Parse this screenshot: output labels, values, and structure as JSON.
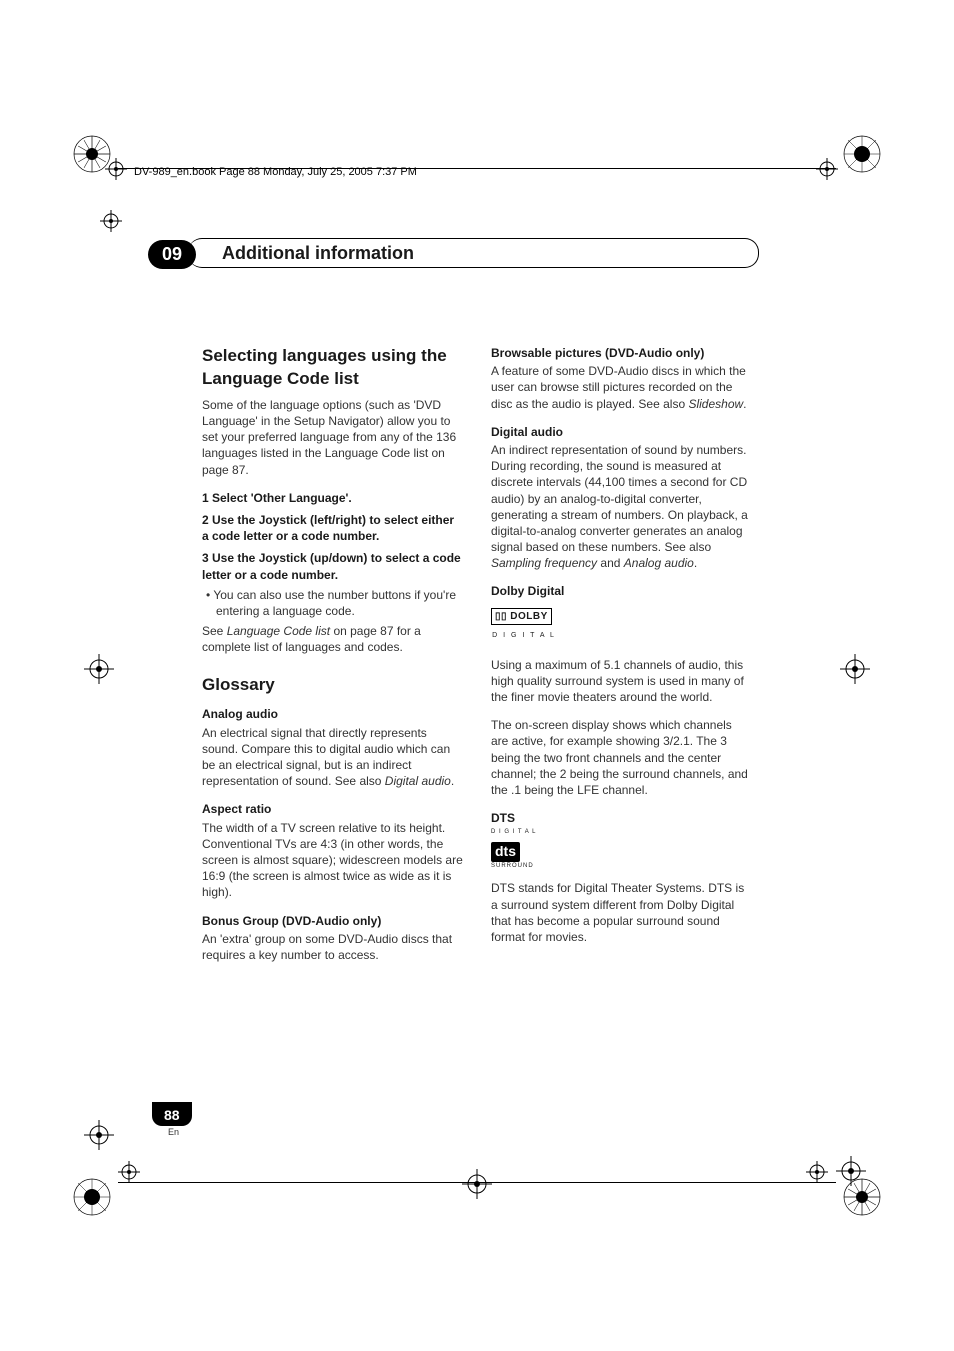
{
  "chapter": {
    "num": "09",
    "title": "Additional information"
  },
  "header_trail": "DV-989_en.book  Page 88  Monday, July 25, 2005  7:37 PM",
  "page_number": "88",
  "page_lang": "En",
  "left": {
    "h1": "Selecting languages using the Language Code list",
    "intro": "Some of the language options (such as 'DVD Language' in the Setup Navigator) allow you to set your preferred language from any of the 136 languages listed in the Language Code list on page 87.",
    "step1": "1    Select 'Other Language'.",
    "step2": "2    Use the Joystick (left/right) to select either a code letter or a code number.",
    "step3": "3    Use the Joystick (up/down) to select a code letter or a code number.",
    "bullet": "• You can also use the number buttons if you're entering a language code.",
    "ref_a": "See ",
    "ref_i": "Language Code list",
    "ref_b": " on page 87 for a complete list of languages and codes.",
    "h2": "Glossary",
    "analog_t": "Analog audio",
    "analog_b_a": "An electrical signal that directly represents sound. Compare this to digital audio which can be an electrical signal, but is an indirect representation of sound. See also ",
    "analog_b_i": "Digital audio",
    "analog_b_c": ".",
    "aspect_t": "Aspect ratio",
    "aspect_b": "The width of a TV screen relative to its height. Conventional TVs are 4:3 (in other words, the screen is almost square); widescreen models are 16:9 (the screen is almost twice as wide as it is high).",
    "bonus_t": "Bonus Group (DVD-Audio only)",
    "bonus_b": "An 'extra' group on some DVD-Audio discs that requires a key number to access."
  },
  "right": {
    "brow_t": "Browsable pictures (DVD-Audio only)",
    "brow_a": "A feature of some DVD-Audio discs in which the user can browse still pictures recorded on the disc as the audio is played. See also ",
    "brow_i": "Slideshow",
    "brow_c": ".",
    "dig_t": "Digital audio",
    "dig_a": "An indirect representation of sound by numbers. During recording, the sound is measured at discrete intervals (44,100 times a second for CD audio) by an analog-to-digital converter, generating a stream of numbers. On playback, a digital-to-analog converter generates an analog signal based on these numbers. See also ",
    "dig_i1": "Sampling frequency",
    "dig_m": " and ",
    "dig_i2": "Analog audio",
    "dig_c": ".",
    "dolby_t": "Dolby Digital",
    "dolby_logo": "DOLBY",
    "dolby_sub": "D I G I T A L",
    "dolby_p1": "Using a maximum of 5.1 channels of audio, this high quality surround system is used in many of the finer movie theaters around the world.",
    "dolby_p2": "The on-screen display shows which channels are active, for example showing 3/2.1. The 3 being the two front channels and the center channel; the 2 being the surround channels, and the .1 being the LFE channel.",
    "dts_t": "DTS",
    "dts_top": "D I G I T A L",
    "dts_logo": "dts",
    "dts_bot": "SURROUND",
    "dts_p": "DTS stands for Digital Theater Systems. DTS is a surround system different from Dolby Digital that has become a popular surround sound format for movies."
  }
}
